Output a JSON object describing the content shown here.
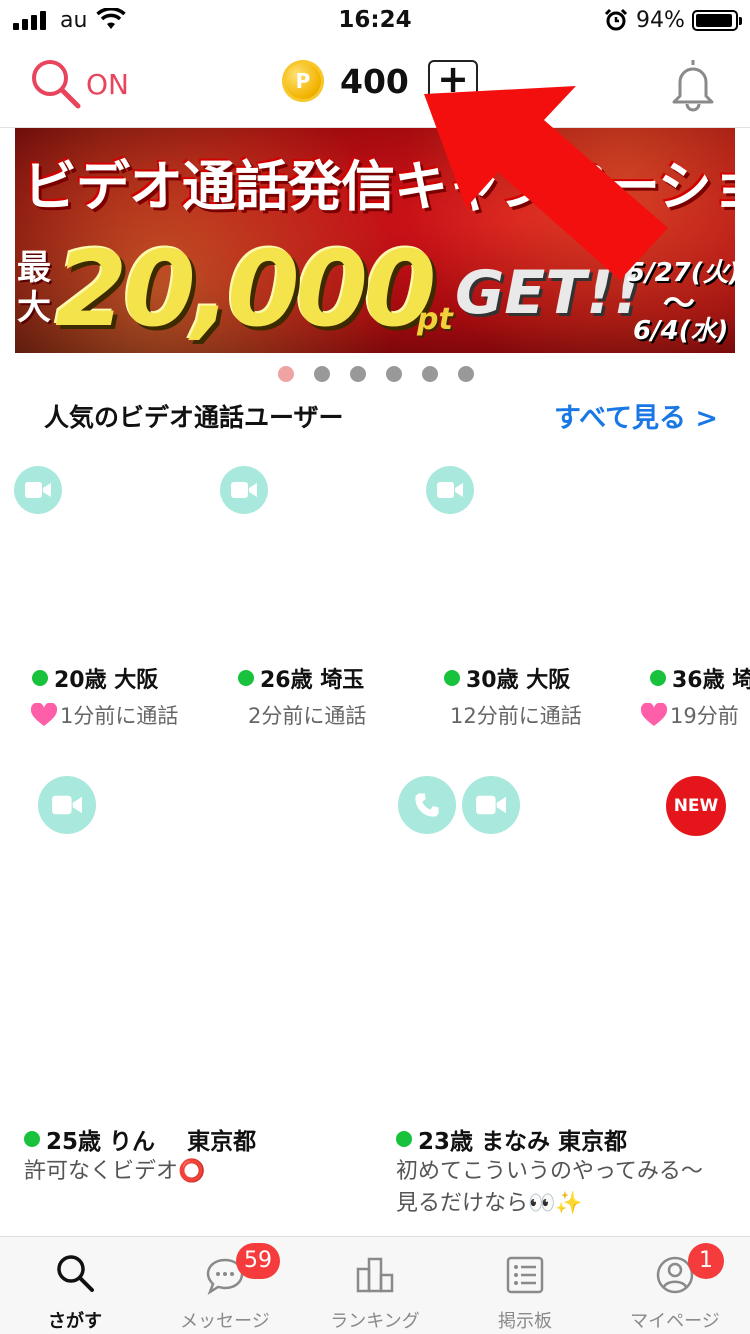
{
  "status_bar": {
    "carrier": "au",
    "time": "16:24",
    "battery": "94%"
  },
  "header": {
    "search_status": "ON",
    "points": "400",
    "add_symbol": "+"
  },
  "banner": {
    "headline": "ビデオ通話発信キャンペーション",
    "prefix": "最大",
    "amount": "20,000",
    "unit": "pt",
    "get": "GET!!",
    "date_start": "5/27(火)",
    "tilde": "〜",
    "date_end": "6/4(水)"
  },
  "carousel": {
    "slides": 6,
    "active": 0
  },
  "section": {
    "title": "人気のビデオ通話ユーザー",
    "see_all": "すべて見る >"
  },
  "popular_users": [
    {
      "age": "20歳",
      "area": "大阪",
      "last_call": "1分前に通話",
      "heart": true
    },
    {
      "age": "26歳",
      "area": "埼玉",
      "last_call": "2分前に通話",
      "heart": false
    },
    {
      "age": "30歳",
      "area": "大阪",
      "last_call": "12分前に通話",
      "heart": false
    },
    {
      "age": "36歳",
      "area": "埼",
      "last_call": "19分前",
      "heart": true
    }
  ],
  "grid_users": [
    {
      "age": "25歳",
      "name": "りん",
      "area": "東京都",
      "message": "許可なくビデオ⭕️"
    },
    {
      "age": "23歳",
      "name": "まなみ",
      "area": "東京都",
      "message": "初めてこういうのやってみる〜見るだけなら👀✨",
      "new_badge": "NEW"
    }
  ],
  "tabs": [
    {
      "label": "さがす",
      "icon": "search-icon",
      "active": true
    },
    {
      "label": "メッセージ",
      "icon": "chat-icon",
      "badge": "59"
    },
    {
      "label": "ランキング",
      "icon": "podium-icon"
    },
    {
      "label": "掲示板",
      "icon": "board-icon"
    },
    {
      "label": "マイページ",
      "icon": "profile-icon",
      "badge": "1"
    }
  ],
  "colors": {
    "accent_pink": "#e8455d",
    "link_blue": "#1a78e6",
    "badge_red": "#f53b3b",
    "online_green": "#18c23c",
    "video_teal": "#a9e8dc"
  }
}
